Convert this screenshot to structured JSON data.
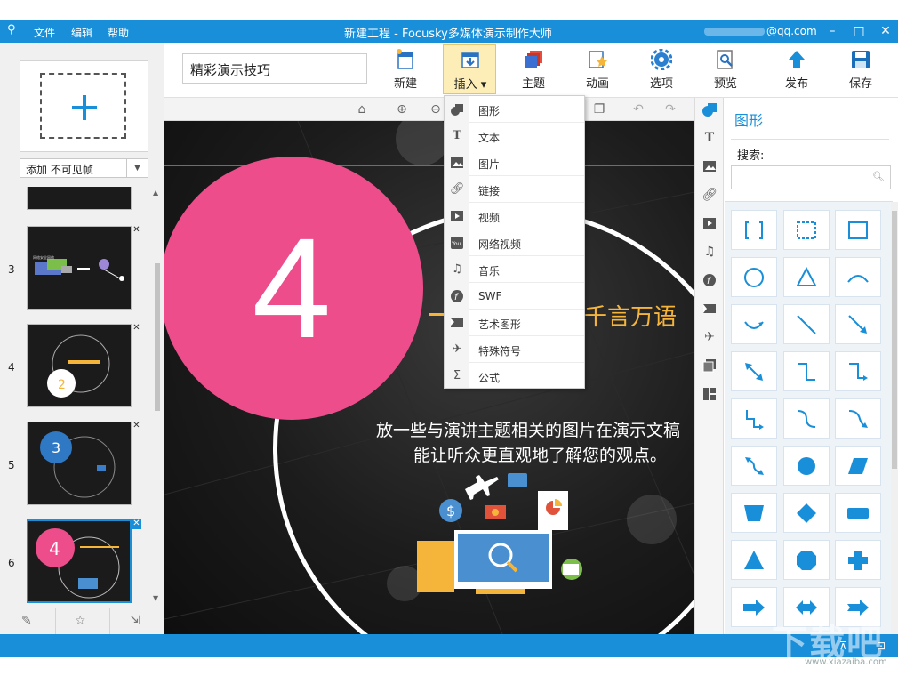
{
  "colors": {
    "accent": "#1a8fd9",
    "pink": "#ee4d8c",
    "orange": "#f5b43a",
    "active_tab": "#fdeeb8"
  },
  "titlebar": {
    "menu": [
      "文件",
      "编辑",
      "帮助"
    ],
    "title": "新建工程 - Focusky多媒体演示制作大师",
    "account": "@qq.com"
  },
  "left": {
    "add_frame_select": "添加 不可见帧",
    "slides": [
      {
        "num": "3",
        "label": ""
      },
      {
        "num": "4",
        "label": "2"
      },
      {
        "num": "5",
        "label": "3"
      },
      {
        "num": "6",
        "label": "4"
      }
    ]
  },
  "toolbar": {
    "project_name": "精彩演示技巧",
    "buttons": [
      "新建",
      "插入",
      "主题",
      "动画",
      "选项",
      "预览",
      "发布",
      "保存"
    ]
  },
  "insert_menu": {
    "items": [
      {
        "icon": "shape-icon",
        "label": "图形"
      },
      {
        "icon": "text-icon",
        "label": "文本"
      },
      {
        "icon": "image-icon",
        "label": "图片"
      },
      {
        "icon": "link-icon",
        "label": "链接"
      },
      {
        "icon": "video-icon",
        "label": "视频"
      },
      {
        "icon": "youtube-icon",
        "label": "网络视频"
      },
      {
        "icon": "music-icon",
        "label": "音乐"
      },
      {
        "icon": "flash-icon",
        "label": "SWF"
      },
      {
        "icon": "art-shape-icon",
        "label": "艺术图形"
      },
      {
        "icon": "plane-icon",
        "label": "特殊符号"
      },
      {
        "icon": "sigma-icon",
        "label": "公式"
      }
    ]
  },
  "canvas": {
    "number": "4",
    "heading": "千言万语",
    "body_line1": "放一些与演讲主题相关的图片在演示文稿",
    "body_line2": "能让听众更直观地了解您的观点。"
  },
  "shapes_panel": {
    "title": "图形",
    "search_label": "搜索:"
  },
  "watermark": {
    "big": "下载吧",
    "small": "www.xiazaiba.com"
  }
}
